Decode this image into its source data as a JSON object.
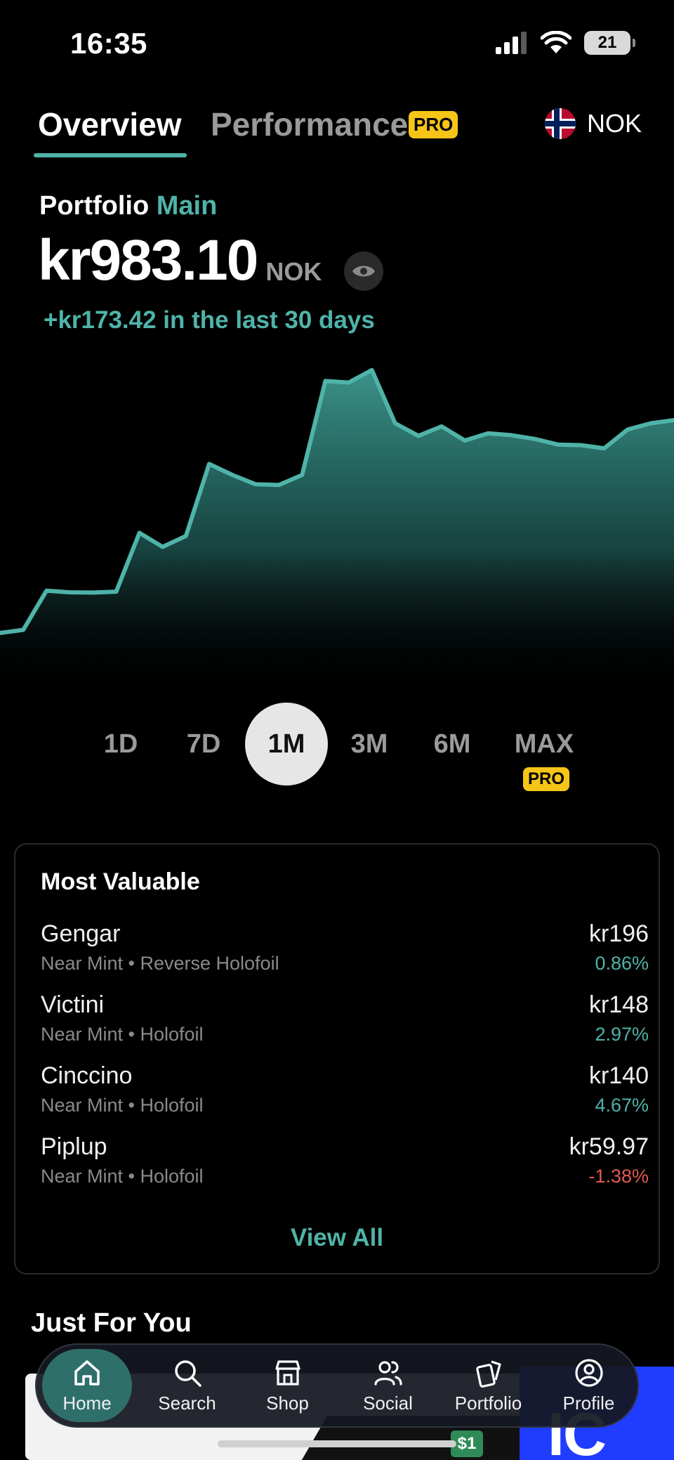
{
  "status_bar": {
    "time": "16:35",
    "battery": "21"
  },
  "tabs": {
    "overview": "Overview",
    "performance": "Performance",
    "performance_badge": "PRO",
    "currency": "NOK"
  },
  "portfolio": {
    "label": "Portfolio",
    "name": "Main",
    "value": "kr983.10",
    "value_currency": "NOK",
    "change_text": "+kr173.42 in the last 30 days"
  },
  "chart_data": {
    "type": "area",
    "title": "",
    "xlabel": "",
    "ylabel": "",
    "grid": false,
    "color": "#4fb3a9",
    "x": [
      1,
      2,
      3,
      4,
      5,
      6,
      7,
      8,
      9,
      10,
      11,
      12,
      13,
      14,
      15,
      16,
      17,
      18,
      19,
      20,
      21,
      22,
      23,
      24,
      25,
      26,
      27,
      28,
      29,
      30
    ],
    "series": [
      {
        "values": [
          200,
          210,
          335,
          330,
          329,
          332,
          520,
          475,
          510,
          740,
          705,
          675,
          673,
          705,
          1005,
          1000,
          1040,
          870,
          830,
          860,
          815,
          838,
          832,
          820,
          802,
          800,
          790,
          850,
          870,
          880
        ]
      }
    ]
  },
  "ranges": {
    "items": [
      "1D",
      "7D",
      "1M",
      "3M",
      "6M",
      "MAX"
    ],
    "active": "1M",
    "max_badge": "PRO"
  },
  "most_valuable": {
    "title": "Most Valuable",
    "items": [
      {
        "name": "Gengar",
        "condition": "Near Mint • Reverse Holofoil",
        "price": "kr196",
        "change": "0.86%",
        "direction": "up"
      },
      {
        "name": "Victini",
        "condition": "Near Mint • Holofoil",
        "price": "kr148",
        "change": "2.97%",
        "direction": "up"
      },
      {
        "name": "Cinccino",
        "condition": "Near Mint • Holofoil",
        "price": "kr140",
        "change": "4.67%",
        "direction": "up"
      },
      {
        "name": "Piplup",
        "condition": "Near Mint • Holofoil",
        "price": "kr59.97",
        "change": "-1.38%",
        "direction": "down"
      }
    ],
    "view_all": "View All"
  },
  "just_for_you": {
    "title": "Just For You",
    "promo_price": "$1",
    "promo_logo": "IC"
  },
  "nav": {
    "items": [
      {
        "label": "Home",
        "icon": "home-icon"
      },
      {
        "label": "Search",
        "icon": "search-icon"
      },
      {
        "label": "Shop",
        "icon": "shop-icon"
      },
      {
        "label": "Social",
        "icon": "social-icon"
      },
      {
        "label": "Portfolio",
        "icon": "portfolio-icon"
      },
      {
        "label": "Profile",
        "icon": "profile-icon"
      }
    ]
  },
  "colors": {
    "accent": "#4fb3a9",
    "positive": "#4fb3a9",
    "negative": "#e05a4f",
    "pro": "#f5c518"
  }
}
